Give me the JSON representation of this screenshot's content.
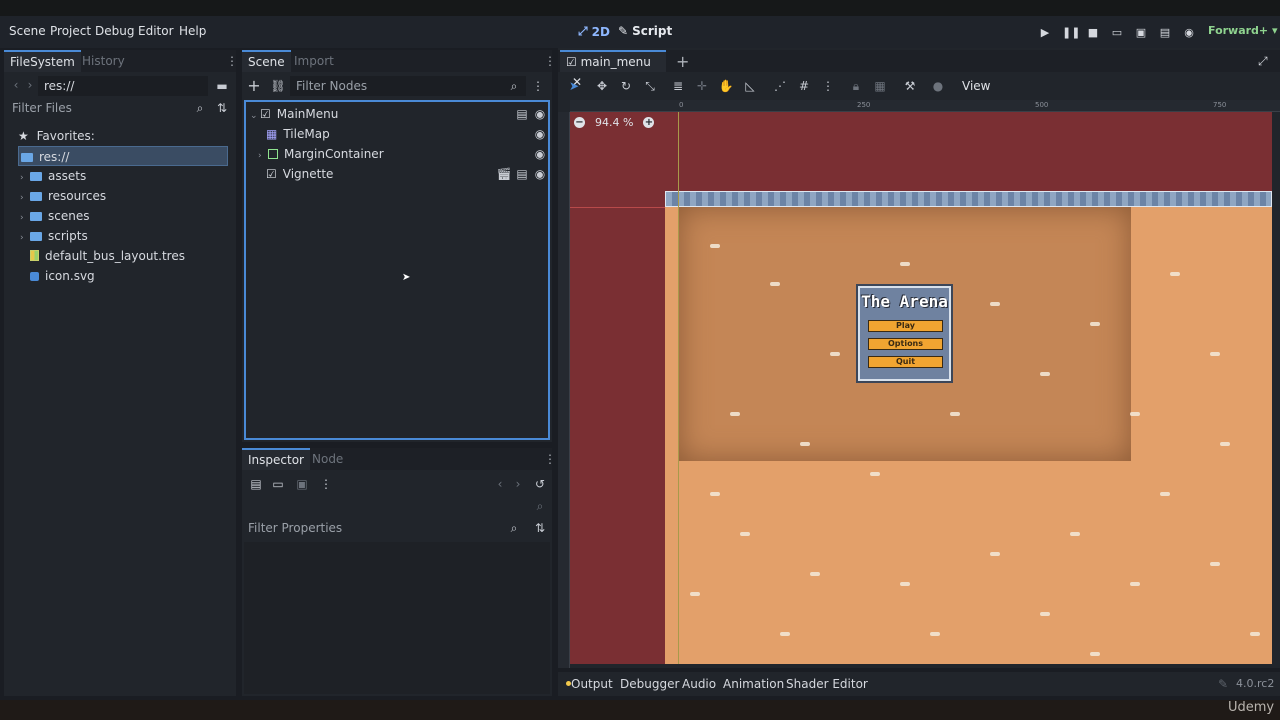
{
  "menu": [
    "Scene",
    "Project",
    "Debug",
    "Editor",
    "Help"
  ],
  "workspaces": [
    {
      "icon": "2d-icon",
      "label": "2D"
    },
    {
      "icon": "script-icon",
      "label": "Script"
    }
  ],
  "renderer": "Forward+",
  "filesystem": {
    "tabs": [
      "FileSystem",
      "History"
    ],
    "path": "res://",
    "filter_placeholder": "Filter Files",
    "favorites_label": "Favorites:",
    "root": "res://",
    "folders": [
      "assets",
      "resources",
      "scenes",
      "scripts"
    ],
    "files": [
      "default_bus_layout.tres",
      "icon.svg"
    ]
  },
  "scene": {
    "tabs": [
      "Scene",
      "Import"
    ],
    "filter_placeholder": "Filter Nodes",
    "nodes": [
      {
        "name": "MainMenu"
      },
      {
        "name": "TileMap"
      },
      {
        "name": "MarginContainer"
      },
      {
        "name": "Vignette"
      }
    ]
  },
  "inspector": {
    "tabs": [
      "Inspector",
      "Node"
    ],
    "filter_placeholder": "Filter Properties"
  },
  "viewport": {
    "tab": "main_menu",
    "zoom": "94.4 %",
    "view_label": "View",
    "ruler_ticks": [
      "0",
      "250",
      "500",
      "750"
    ],
    "game_title": "The Arena",
    "game_buttons": [
      "Play",
      "Options",
      "Quit"
    ]
  },
  "bottom_tabs": [
    "Output",
    "Debugger",
    "Audio",
    "Animation",
    "Shader Editor"
  ],
  "version": "4.0.rc2",
  "watermark": "Udemy",
  "colors": {
    "accent": "#4a8ad6",
    "canvas_bg": "#7a2f33",
    "sand": "#e3a06a",
    "button": "#f1a531",
    "output_dot": "#f2c94c"
  }
}
